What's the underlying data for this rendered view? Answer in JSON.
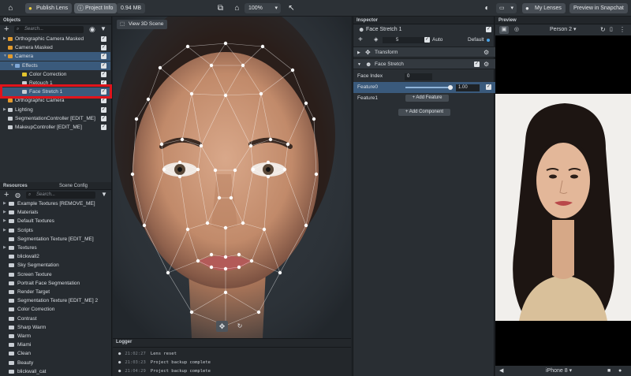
{
  "topbar": {
    "publish_label": "Publish Lens",
    "project_info_label": "Project Info",
    "size_label": "0.94 MB",
    "zoom": "100%",
    "my_lenses_label": "My Lenses",
    "preview_snapchat_label": "Preview in Snapchat"
  },
  "objects": {
    "title": "Objects",
    "search_placeholder": "Search...",
    "items": [
      {
        "label": "Orthographic Camera Masked",
        "color": "#e39b2d"
      },
      {
        "label": "Camera Masked",
        "color": "#e39b2d"
      },
      {
        "label": "Camera",
        "color": "#e39b2d"
      },
      {
        "label": "Effects",
        "color": "#7fa7d6"
      },
      {
        "label": "Color Correction",
        "color": "#e3c42d"
      },
      {
        "label": "Retouch 1",
        "color": "#c9ced4"
      },
      {
        "label": "Face Stretch 1",
        "color": "#c9ced4"
      },
      {
        "label": "Orthographic Camera",
        "color": "#e39b2d"
      },
      {
        "label": "Lighting",
        "color": "#c9ced4"
      },
      {
        "label": "SegmentationController [EDIT_ME]",
        "color": "#c9ced4"
      },
      {
        "label": "MakeupController [EDIT_ME]",
        "color": "#c9ced4"
      }
    ]
  },
  "resources": {
    "tab_resources": "Resources",
    "tab_scene_config": "Scene Config",
    "search_placeholder": "Search...",
    "items": [
      "Example Textures [REMOVE_ME]",
      "Materials",
      "Default Textures",
      "Scripts",
      "Segmentation Texture [EDIT_ME]",
      "Textures",
      "blickwall2",
      "Sky Segmentation",
      "Screen Texture",
      "Portrait Face Segmentation",
      "Render Target",
      "Segmentation Texture [EDIT_ME] 2",
      "Color Correction",
      "Contrast",
      "Sharp Warm",
      "Warm",
      "Miami",
      "Clean",
      "Beauty",
      "blickwall_cat"
    ]
  },
  "viewport": {
    "view3d_label": "View 3D Scene"
  },
  "logger": {
    "title": "Logger",
    "entries": [
      {
        "time": "21:02:27",
        "msg": "Lens reset"
      },
      {
        "time": "21:03:23",
        "msg": "Project backup complete"
      },
      {
        "time": "21:04:29",
        "msg": "Project backup complete"
      }
    ]
  },
  "inspector": {
    "title": "Inspector",
    "object_name": "Face Stretch 1",
    "layer_value": "5",
    "auto_label": "Auto",
    "default_label": "Default",
    "transform_label": "Transform",
    "component_label": "Face Stretch",
    "face_index_label": "Face Index",
    "face_index_value": "0",
    "feature0_label": "Feature0",
    "feature0_value": "1.00",
    "feature0_level": 1.0,
    "feature1_label": "Feature1",
    "add_feature_label": "Add Feature",
    "add_component_label": "Add Component"
  },
  "preview": {
    "title": "Preview",
    "person_label": "Person 2",
    "device_label": "iPhone 8"
  },
  "colors": {
    "selection": "#3a5a7c",
    "highlight_box": "#e0141c",
    "accent": "#4aa3e6"
  }
}
